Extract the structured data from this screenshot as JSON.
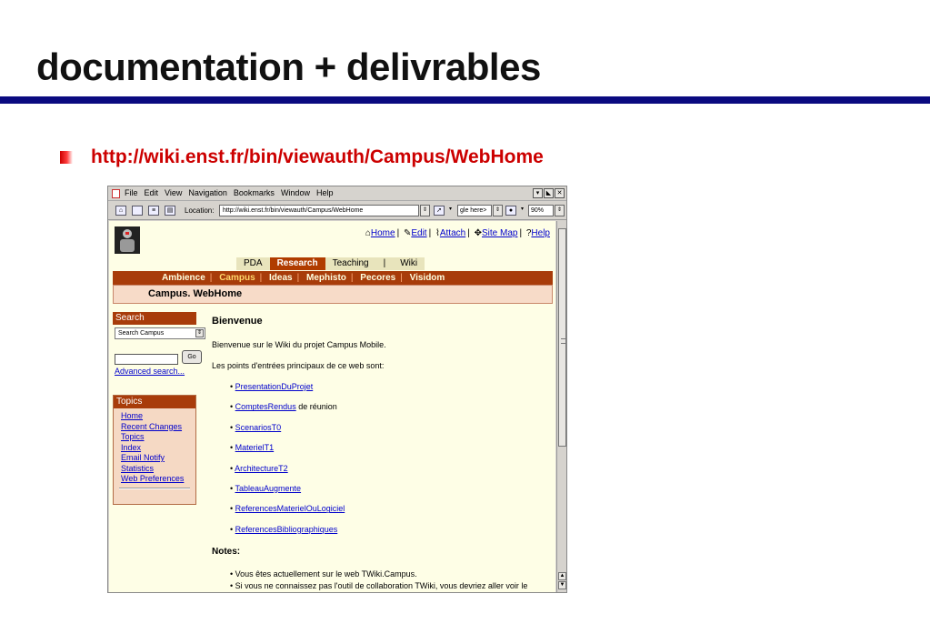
{
  "slide": {
    "title": "documentation + delivrables",
    "url": "http://wiki.enst.fr/bin/viewauth/Campus/WebHome"
  },
  "browser": {
    "menu": [
      "File",
      "Edit",
      "View",
      "Navigation",
      "Bookmarks",
      "Window",
      "Help"
    ],
    "location_label": "Location:",
    "location_value": "http://wiki.enst.fr/bin/viewauth/Campus/WebHome",
    "search_value": "gle here>",
    "zoom": "90%"
  },
  "page": {
    "top_links": [
      "Home",
      "Edit",
      "Attach",
      "Site Map",
      "Help"
    ],
    "web_tabs": [
      "PDA",
      "Research",
      "Teaching",
      "Wiki"
    ],
    "subnav": [
      "Ambience",
      "Campus",
      "Ideas",
      "Mephisto",
      "Pecores",
      "Visidom"
    ],
    "breadcrumb": "Campus. WebHome",
    "search": {
      "header": "Search",
      "scope": "Search Campus",
      "go": "Go",
      "advanced": "Advanced search..."
    },
    "topics": {
      "header": "Topics",
      "items": [
        "Home",
        "Recent Changes",
        "Topics",
        "Index",
        "Email Notify",
        "Statistics",
        "Web Preferences"
      ]
    },
    "content": {
      "heading": "Bienvenue",
      "intro": "Bienvenue sur le Wiki du projet Campus Mobile.",
      "lead": "Les points d'entrées principaux de ce web sont:",
      "links": [
        {
          "link": "PresentationDuProjet",
          "after": ""
        },
        {
          "link": "ComptesRendus",
          "after": "de réunion"
        },
        {
          "link": "ScenariosT0",
          "after": ""
        },
        {
          "link": "MaterielT1",
          "after": ""
        },
        {
          "link": "ArchitectureT2",
          "after": ""
        },
        {
          "link": "TableauAugmente",
          "after": ""
        },
        {
          "link": "ReferencesMaterielOuLogiciel",
          "after": ""
        },
        {
          "link": "ReferencesBibliographiques",
          "after": ""
        }
      ],
      "notes_label": "Notes:",
      "notes": [
        "Vous êtes actuellement sur le web TWiki.Campus.",
        "Si vous ne connaissez pas l'outil de collaboration TWiki, vous devriez aller voir le"
      ]
    }
  },
  "colors": {
    "title_rule": "#0a0a80",
    "url_text": "#cc0000",
    "nav_bar": "#a83c0a",
    "page_bg": "#fefee6"
  }
}
